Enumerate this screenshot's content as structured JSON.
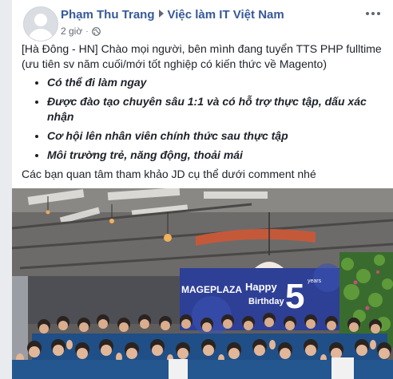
{
  "post": {
    "author": "Phạm Thu Trang",
    "group": "Việc làm IT Việt Nam",
    "time": "2 giờ",
    "separator": "·",
    "privacy_icon": "globe-icon",
    "more_icon": "more-options-icon",
    "intro": "[Hà Đông - HN] Chào mọi người, bên mình đang tuyển TTS PHP fulltime (ưu tiên sv năm cuối/mới tốt nghiệp có kiến thức về Magento)",
    "bullets": [
      "Có thể đi làm ngay",
      "Được đào tạo chuyên sâu 1:1 và có hỗ trợ thực tập, dấu xác nhận",
      "Cơ hội lên nhân viên chính thức sau thực tập",
      "Môi trường trẻ, năng động, thoải mái"
    ],
    "closing": "Các bạn quan tâm tham khảo JD cụ thể dưới comment nhé"
  },
  "photo": {
    "banner_brand": "MAGEPLAZA",
    "banner_text_happy": "Happy",
    "banner_text_birthday": "Birthday",
    "banner_number": "5",
    "banner_suffix": "years"
  },
  "colors": {
    "link": "#365899",
    "text": "#1d2129",
    "meta": "#616770",
    "banner": "#2e3f96",
    "shirt": "#1f4f86"
  }
}
